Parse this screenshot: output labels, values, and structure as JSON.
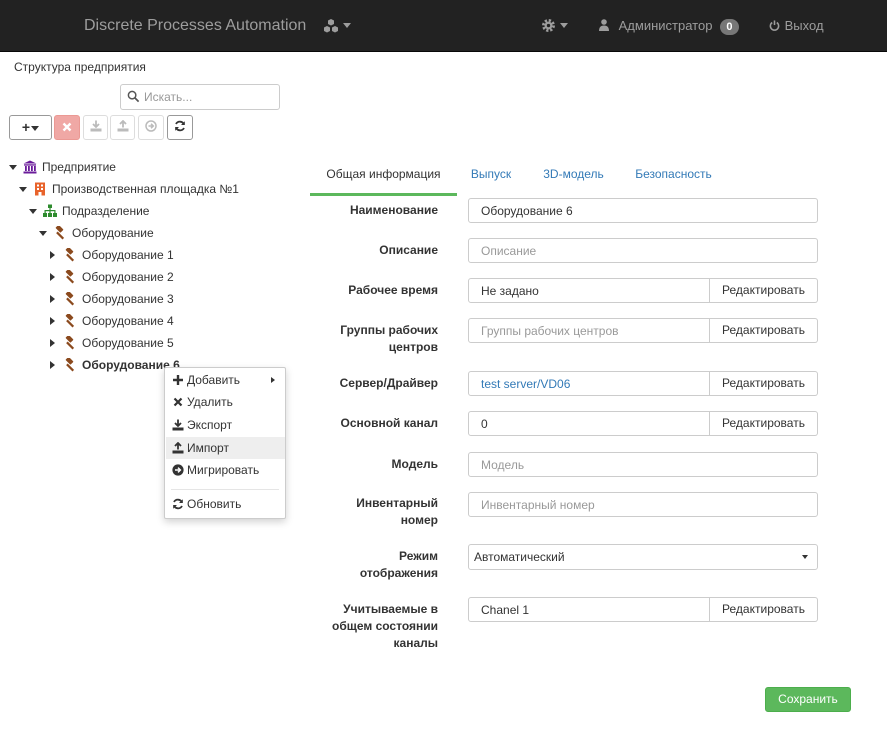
{
  "navbar": {
    "brand": "Discrete Processes Automation",
    "user": "Администратор",
    "user_badge": "0",
    "logout": "Выход"
  },
  "left": {
    "title": "Структура предприятия",
    "search_placeholder": "Искать..."
  },
  "tree": {
    "root": "Предприятие",
    "site": "Производственная площадка №1",
    "division": "Подразделение",
    "equipment_group": "Оборудование",
    "items": [
      "Оборудование 1",
      "Оборудование 2",
      "Оборудование 3",
      "Оборудование 4",
      "Оборудование 5",
      "Оборудование 6"
    ],
    "selected": "Оборудование 6"
  },
  "context_menu": {
    "add": "Добавить",
    "delete": "Удалить",
    "export": "Экспорт",
    "import": "Импорт",
    "migrate": "Мигрировать",
    "refresh": "Обновить",
    "highlighted": "Импорт"
  },
  "tabs": [
    "Общая информация",
    "Выпуск",
    "3D-модель",
    "Безопасность"
  ],
  "active_tab": "Общая информация",
  "form": {
    "name_label": "Наименование",
    "name_value": "Оборудование 6",
    "description_label": "Описание",
    "description_placeholder": "Описание",
    "worktime_label": "Рабочее время",
    "worktime_value": "Не задано",
    "wc_groups_label_1": "Группы рабочих",
    "wc_groups_label_2": "центров",
    "wc_groups_placeholder": "Группы рабочих центров",
    "server_label": "Сервер/Драйвер",
    "server_value": "test server/VD06",
    "main_channel_label": "Основной канал",
    "main_channel_value": "0",
    "model_label": "Модель",
    "model_placeholder": "Модель",
    "inventory_label_1": "Инвентарный",
    "inventory_label_2": "номер",
    "inventory_placeholder": "Инвентарный номер",
    "display_mode_label_1": "Режим",
    "display_mode_label_2": "отображения",
    "display_mode_value": "Автоматический",
    "channels_label_1": "Учитываемые в",
    "channels_label_2": "общем состоянии",
    "channels_label_3": "каналы",
    "channels_value": "Chanel 1",
    "edit_label": "Редактировать",
    "save_label": "Сохранить"
  },
  "colors": {
    "navbar_bg": "#222222",
    "accent_green": "#5cb85c",
    "link_blue": "#337ab7",
    "enterprise_icon": "#6a1b9a",
    "site_icon": "#e8632b",
    "division_icon": "#2e8b2e",
    "equipment_icon": "#8b4a1e",
    "delete_button": "#f0a8a5"
  }
}
